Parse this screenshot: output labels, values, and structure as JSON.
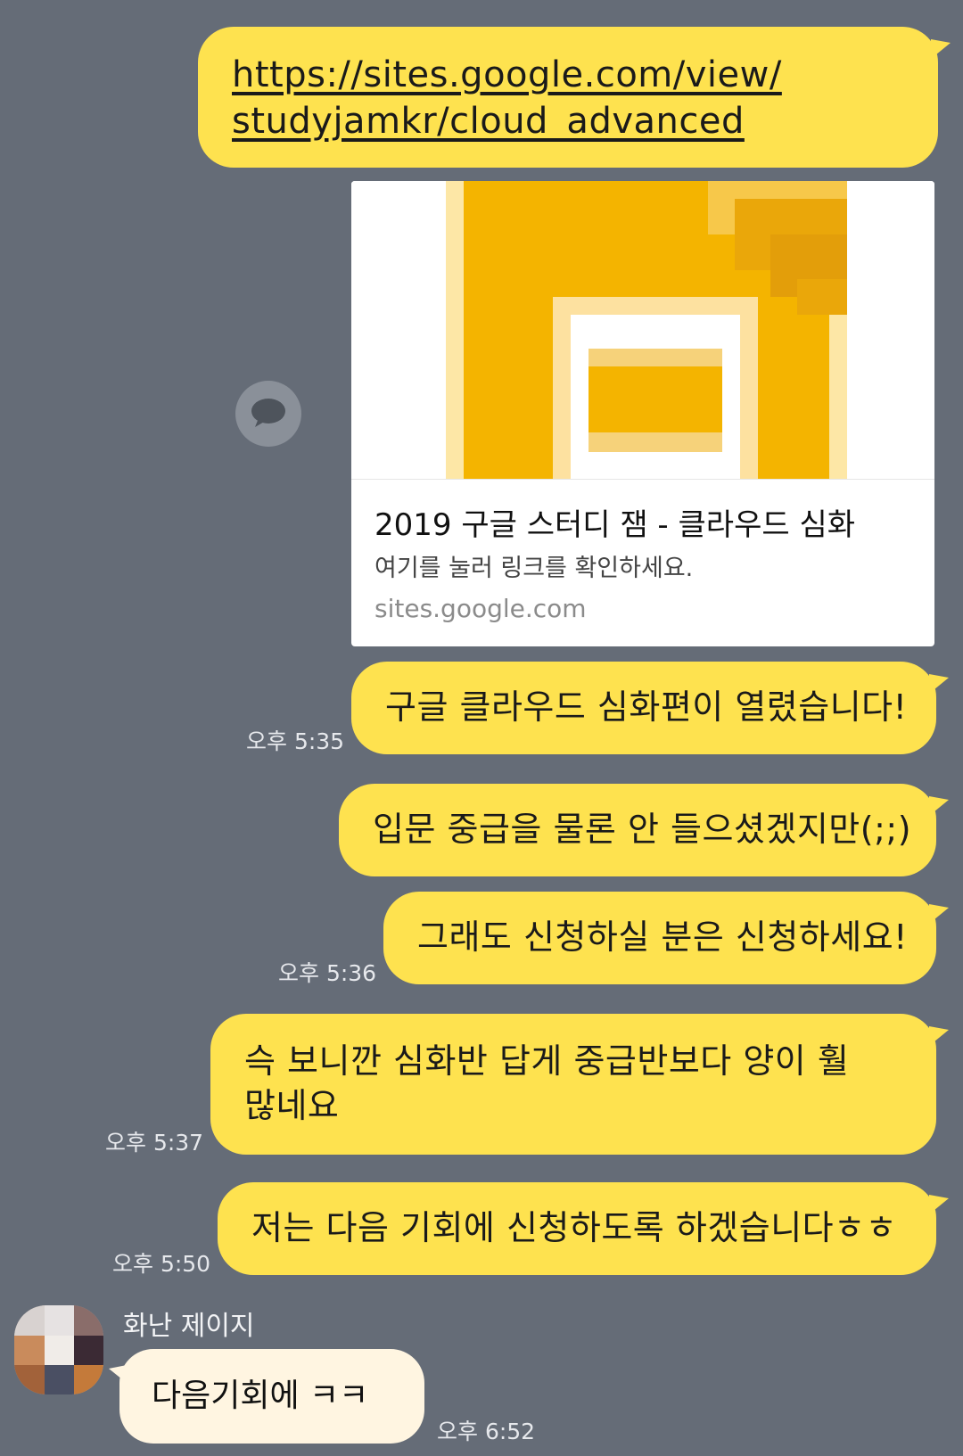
{
  "chat": {
    "link_message": {
      "line1": "https://sites.google.com/view/",
      "line2": "studyjamkr/cloud_advanced"
    },
    "link_card": {
      "title": "2019 구글 스터디 잼 - 클라우드 심화",
      "description": "여기를 눌러 링크를 확인하세요.",
      "domain": "sites.google.com"
    },
    "messages": [
      {
        "text": "구글 클라우드 심화편이 열렸습니다!",
        "time": "오후 5:35"
      },
      {
        "text": "입문 중급을 물론 안 들으셨겠지만(;;)",
        "time": ""
      },
      {
        "text": "그래도 신청하실 분은 신청하세요!",
        "time": "오후 5:36"
      },
      {
        "line1": "슥 보니깐 심화반 답게 중급반보다 양이 훨",
        "line2": "많네요",
        "time": "오후 5:37"
      },
      {
        "text": "저는 다음 기회에 신청하도록 하겠습니다ㅎㅎ",
        "time": "오후 5:50"
      }
    ],
    "incoming": {
      "sender": "화난 제이지",
      "text": "다음기회에 ㅋㅋ",
      "time": "오후 6:52"
    }
  },
  "colors": {
    "background": "#656c77",
    "my_bubble": "#fee24f",
    "their_bubble": "#fff5e1",
    "card_yellow": "#f4b400"
  },
  "icons": {
    "share": "speech-bubble-icon",
    "avatar": "pixelated-avatar"
  }
}
